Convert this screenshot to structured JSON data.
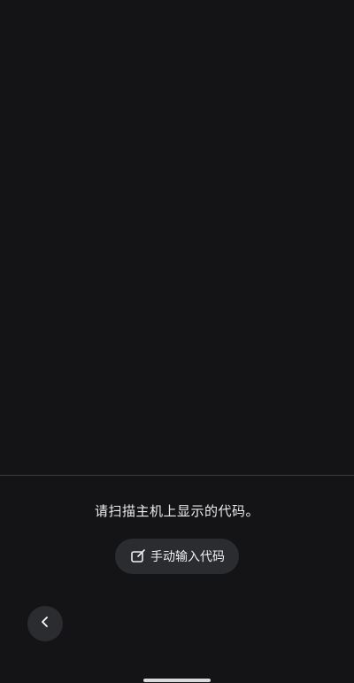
{
  "instruction": {
    "text": "请扫描主机上显示的代码。"
  },
  "manual_entry": {
    "label": "手动输入代码",
    "icon": "edit-icon"
  },
  "navigation": {
    "back_icon": "chevron-left-icon"
  },
  "colors": {
    "background": "#141416",
    "button_background": "#2b2c30",
    "text": "#ececec",
    "divider": "#3a3b3e"
  }
}
